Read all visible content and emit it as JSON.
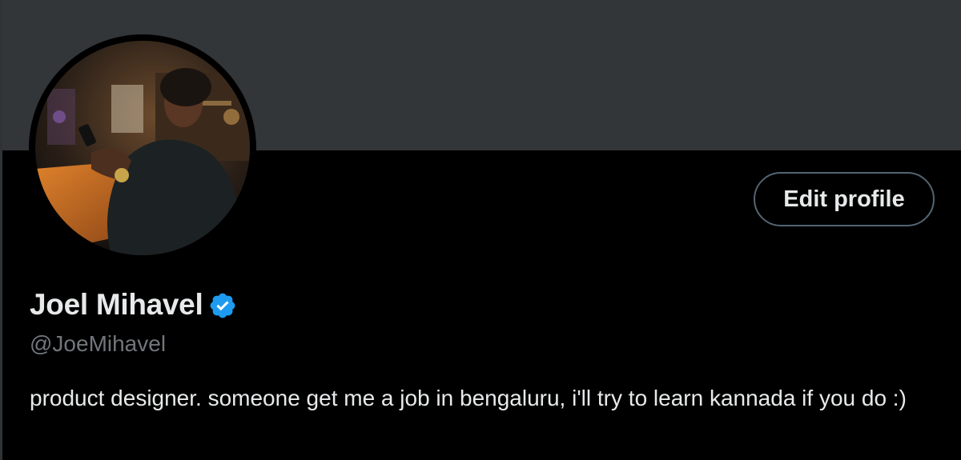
{
  "profile": {
    "display_name": "Joel Mihavel",
    "handle": "@JoeMihavel",
    "bio": "product designer. someone get me a job in bengaluru, i'll try to learn kannada if you do :)",
    "verified": true,
    "edit_button_label": "Edit profile"
  },
  "colors": {
    "background": "#000000",
    "banner": "#333639",
    "text_primary": "#e7e9ea",
    "text_secondary": "#71767b",
    "verified_badge": "#1d9bf0",
    "button_border": "#536471"
  },
  "icons": {
    "verified": "verified-badge-icon"
  }
}
